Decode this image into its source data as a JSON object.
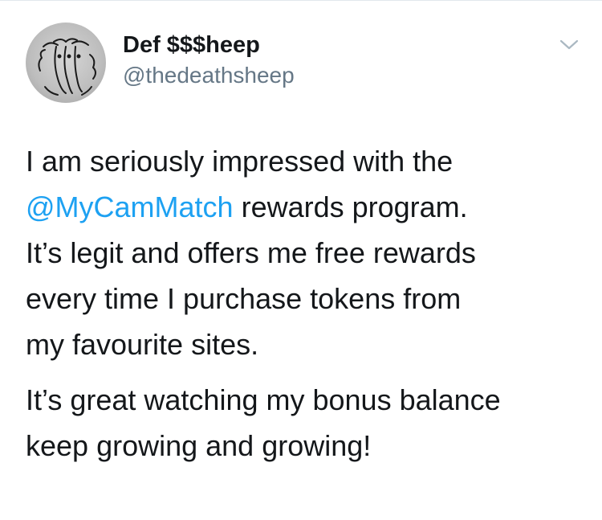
{
  "tweet": {
    "author": {
      "display_name": "Def $$$heep",
      "handle": "@thedeathsheep",
      "avatar_icon": "sheep-drawing-avatar"
    },
    "menu_icon": "chevron-down-icon",
    "paragraph1": {
      "line1": "I am seriously impressed with the",
      "mention": "@MyCamMatch",
      "line2_rest": " rewards program.",
      "line3": "It’s legit and offers me free rewards",
      "line4": "every time I purchase tokens from",
      "line5": "my favourite sites."
    },
    "paragraph2": {
      "line1": "It’s great watching my bonus balance",
      "line2": "keep growing and growing!"
    }
  },
  "colors": {
    "mention": "#1da1f2",
    "handle": "#657786",
    "text": "#14171a"
  }
}
